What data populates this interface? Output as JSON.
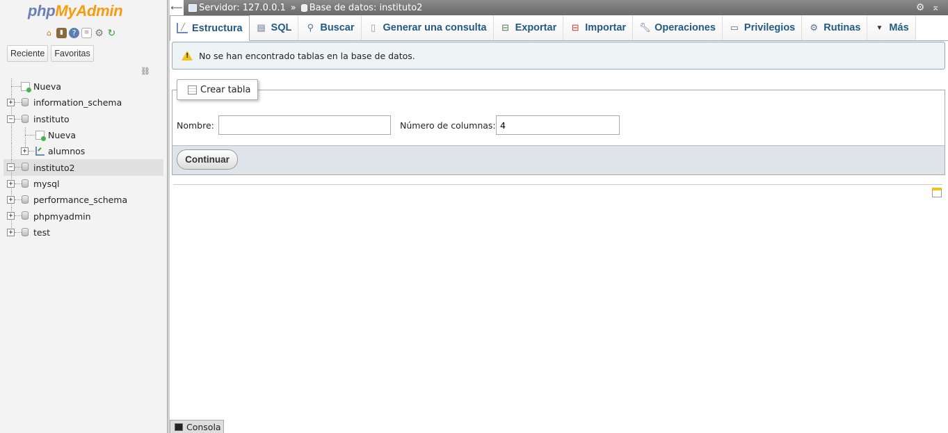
{
  "app": {
    "logo_php": "php",
    "logo_my": "My",
    "logo_admin": "Admin"
  },
  "sidebar": {
    "quick_icons": [
      "home-icon",
      "exit-icon",
      "help-icon",
      "docs-icon",
      "settings-icon",
      "reload-icon"
    ],
    "recent_label": "Reciente",
    "favorites_label": "Favoritas",
    "tree": [
      {
        "label": "Nueva",
        "type": "new",
        "level": 0
      },
      {
        "label": "information_schema",
        "type": "db",
        "level": 0
      },
      {
        "label": "instituto",
        "type": "db",
        "level": 0,
        "expanded": true
      },
      {
        "label": "Nueva",
        "type": "new",
        "level": 1
      },
      {
        "label": "alumnos",
        "type": "table",
        "level": 1
      },
      {
        "label": "instituto2",
        "type": "db",
        "level": 0,
        "expanded": true,
        "selected": true
      },
      {
        "label": "mysql",
        "type": "db",
        "level": 0
      },
      {
        "label": "performance_schema",
        "type": "db",
        "level": 0
      },
      {
        "label": "phpmyadmin",
        "type": "db",
        "level": 0
      },
      {
        "label": "test",
        "type": "db",
        "level": 0
      }
    ]
  },
  "topbar": {
    "back_glyph": "⟵",
    "server_label": "Servidor: 127.0.0.1",
    "separator": "»",
    "database_label": "Base de datos: instituto2"
  },
  "tabs": [
    {
      "label": "Estructura",
      "icon": "structure-icon",
      "active": true
    },
    {
      "label": "SQL",
      "icon": "sql-icon"
    },
    {
      "label": "Buscar",
      "icon": "search-icon"
    },
    {
      "label": "Generar una consulta",
      "icon": "query-icon"
    },
    {
      "label": "Exportar",
      "icon": "export-icon"
    },
    {
      "label": "Importar",
      "icon": "import-icon"
    },
    {
      "label": "Operaciones",
      "icon": "wrench-icon"
    },
    {
      "label": "Privilegios",
      "icon": "privileges-icon"
    },
    {
      "label": "Rutinas",
      "icon": "routines-icon"
    },
    {
      "label": "Más",
      "icon": "caret-down-icon"
    }
  ],
  "notice": {
    "text": "No se han encontrado tablas en la base de datos."
  },
  "create_table": {
    "legend": "Crear tabla",
    "name_label": "Nombre:",
    "name_value": "",
    "columns_label": "Número de columnas:",
    "columns_value": "4",
    "submit_label": "Continuar"
  },
  "console": {
    "label": "Consola"
  },
  "colors": {
    "tab_text": "#235a81",
    "notice_bg": "#eef3f6",
    "topbar_bg": "#777777"
  }
}
